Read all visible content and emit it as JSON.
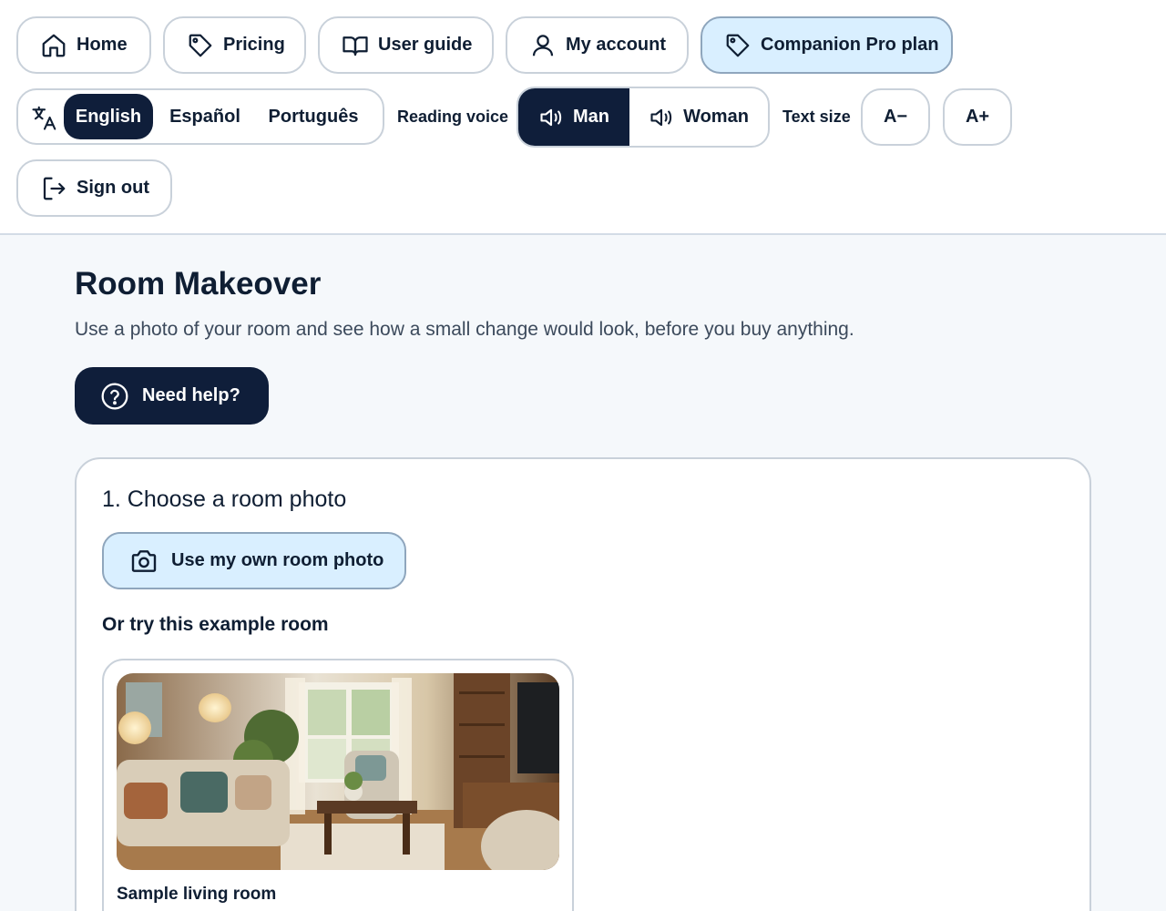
{
  "nav": {
    "home": "Home",
    "pricing": "Pricing",
    "user_guide": "User guide",
    "my_account": "My account",
    "pro_plan": "Companion Pro plan",
    "sign_out": "Sign out"
  },
  "language": {
    "options": [
      "English",
      "Español",
      "Português"
    ],
    "selected": "English"
  },
  "voice": {
    "label": "Reading voice",
    "options": [
      "Man",
      "Woman"
    ],
    "selected": "Man"
  },
  "text_size": {
    "label": "Text size",
    "decrease": "A−",
    "increase": "A+"
  },
  "page": {
    "title": "Room Makeover",
    "subtitle": "Use a photo of your room and see how a small change would look, before you buy anything.",
    "help_label": "Need help?"
  },
  "step1": {
    "title": "1. Choose a room photo",
    "upload_label": "Use my own room photo",
    "or_label": "Or try this example room",
    "sample_caption": "Sample living room"
  },
  "colors": {
    "accent_dark": "#0f1e3a",
    "accent_light": "#d9efff"
  }
}
